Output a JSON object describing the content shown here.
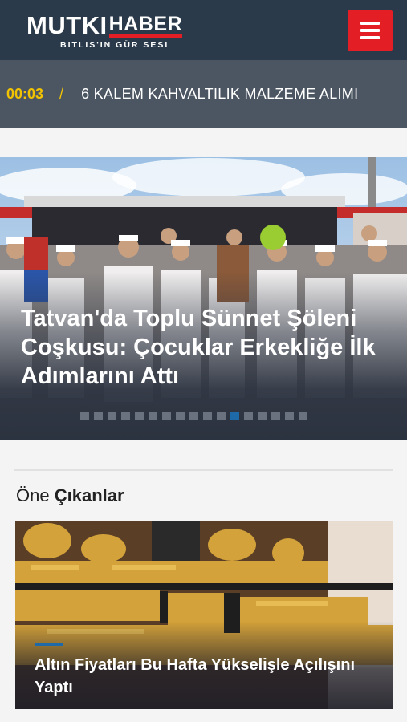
{
  "header": {
    "logo_mutki": "MUTKI",
    "logo_haber": "HABER",
    "logo_tagline": "BITLIS'IN GÜR SESI",
    "menu_icon": "hamburger-menu-icon",
    "bg_color": "#2a3a4a",
    "accent_color": "#e31e24"
  },
  "ticker": {
    "time": "00:03",
    "separator": "/",
    "headline": "6 KALEM KAHVALTILIK MALZEME ALIMI"
  },
  "slider": {
    "title": "Tatvan'da Toplu Sünnet Şöleni Coşkusu: Çocuklar Erkekliğe İlk Adımlarını Attı",
    "dot_count": 17,
    "active_dot": 11,
    "active_color": "#1e6aa8"
  },
  "featured": {
    "heading_light": "Öne",
    "heading_bold": "Çıkanlar",
    "card_title": "Altın Fiyatları Bu Hafta Yükselişle Açılışını Yaptı"
  }
}
